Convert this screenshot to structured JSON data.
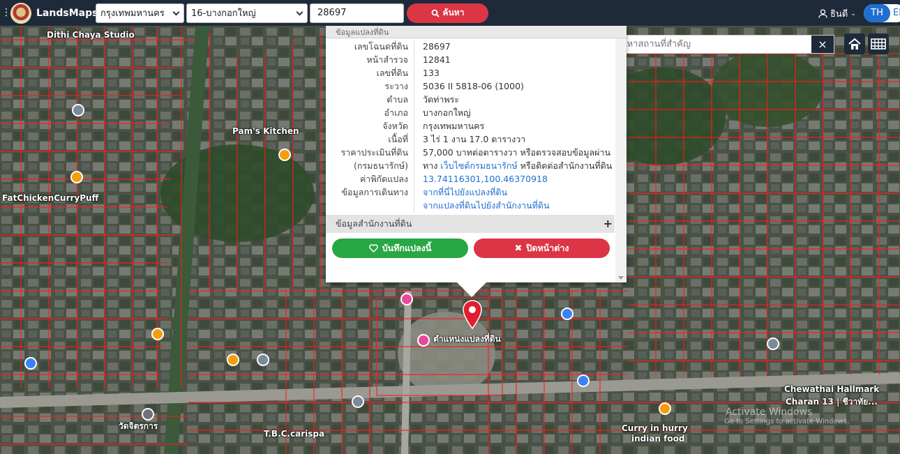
{
  "header": {
    "brand": "LandsMaps",
    "province": "กรุงเทพมหานคร",
    "district": "16-บางกอกใหญ่",
    "deed_number": "28697",
    "search_label": "ค้นหา",
    "user_name": "ธินดี",
    "lang_active": "TH",
    "lang_other": "EN"
  },
  "map": {
    "place_search_placeholder": "ค้นหาสถานที่สำคัญ",
    "labels": {
      "dithi_chaya": "Dithi Chaya Studio",
      "pams_kitchen": "Pam's Kitchen",
      "fat_chicken": "FatChickenCurryPuff",
      "land_marker": "ตำแหน่งแปลงที่ดิน",
      "chewathai": "Chewathai Hallmark",
      "charan": "Charan 13 | ชีวาทัย...",
      "tbc_caris": "T.B.C.carispa",
      "curry_hurry": "Curry in hurry",
      "indian_food": "indian food",
      "rongrian_wat": "วัดจิตรการ",
      "watermark_title": "Activate Windows",
      "watermark_sub": "Go to Settings to activate Windows."
    }
  },
  "popup": {
    "header": "ข้อมูลแปลงที่ดิน",
    "rows": [
      {
        "label": "เลขโฉนดที่ดิน",
        "value": "28697"
      },
      {
        "label": "หน้าสำรวจ",
        "value": "12841"
      },
      {
        "label": "เลขที่ดิน",
        "value": "133"
      },
      {
        "label": "ระวาง",
        "value": "5036 II 5818-06 (1000)"
      },
      {
        "label": "ตำบล",
        "value": "วัดท่าพระ"
      },
      {
        "label": "อำเภอ",
        "value": "บางกอกใหญ่"
      },
      {
        "label": "จังหวัด",
        "value": "กรุงเทพมหานคร"
      },
      {
        "label": "เนื้อที่",
        "value": "3 ไร่ 1 งาน 17.0 ตารางวา"
      },
      {
        "label": "ราคาประเมินที่ดิน",
        "value": "57,000 บาทต่อตารางวา หรือตรวจสอบข้อมูลผ่าน"
      },
      {
        "label": "(กรมธนารักษ์)",
        "value_prefix": "ทาง ",
        "value_link": "เว็บไซต์กรมธนารักษ์",
        "value_suffix": " หรือติดต่อสำนักงานที่ดิน"
      },
      {
        "label": "ค่าพิกัดแปลง",
        "value_link": "13.74116301,100.46370918"
      },
      {
        "label": "ข้อมูลการเดินทาง",
        "value_link": "จากที่นี่ไปยังแปลงที่ดิน"
      },
      {
        "label": "",
        "value_link": "จากแปลงที่ดินไปยังสำนักงานที่ดิน"
      }
    ],
    "office_section": "ข้อมูลสำนักงานที่ดิน",
    "save_label": "บันทึกแปลงนี้",
    "close_label": "ปิดหน้าต่าง"
  },
  "colors": {
    "topbar": "#1e2a3a",
    "danger": "#dc3545",
    "success": "#28a745",
    "link": "#1f6fd1",
    "parcel_line": "#ff1a1a"
  }
}
